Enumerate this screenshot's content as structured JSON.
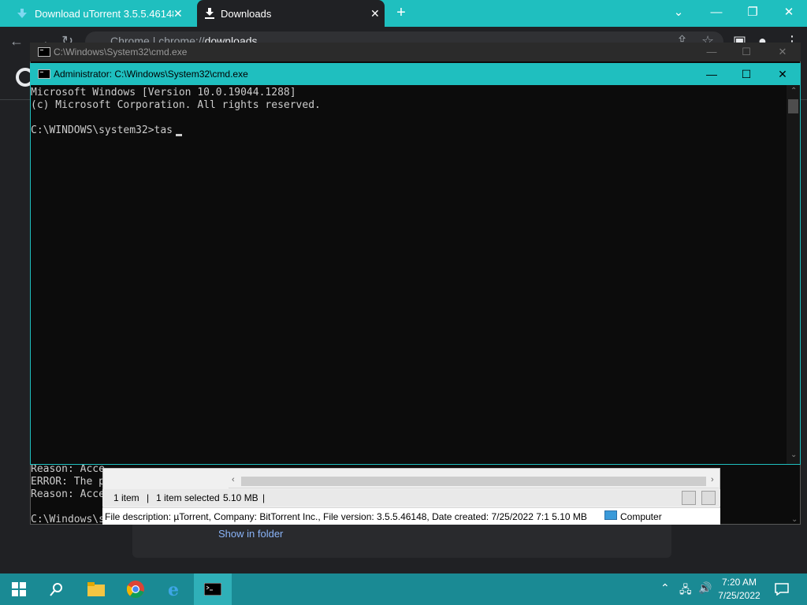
{
  "chrome": {
    "tabs": [
      {
        "label": "Download uTorrent 3.5.5.46148 f",
        "icon": "utorrent-download-icon"
      },
      {
        "label": "Downloads",
        "icon": "download-icon"
      }
    ],
    "omnibox": {
      "prefix": "Chrome",
      "separator": "|",
      "scheme": "chrome://",
      "path": "downloads"
    },
    "downloads_page": {
      "show_in_folder": "Show in folder"
    }
  },
  "cmd_back": {
    "title": "C:\\Windows\\System32\\cmd.exe",
    "lines": [
      "Reason: Acce",
      "ERROR: The p",
      "Reason: Acce",
      "",
      "C:\\Windows\\s"
    ]
  },
  "cmd_front": {
    "title": "Administrator: C:\\Windows\\System32\\cmd.exe",
    "lines": [
      "Microsoft Windows [Version 10.0.19044.1288]",
      "(c) Microsoft Corporation. All rights reserved.",
      "",
      "C:\\WINDOWS\\system32>tas"
    ]
  },
  "explorer": {
    "status_items": "1 item",
    "status_sep": "|",
    "status_selected": "1 item selected",
    "status_size": "5.10 MB",
    "status_sep2": "|",
    "details": "File description: µTorrent, Company: BitTorrent Inc., File version: 3.5.5.46148, Date created: 7/25/2022 7:1 5.10 MB",
    "location": "Computer"
  },
  "taskbar": {
    "time": "7:20 AM",
    "date": "7/25/2022"
  },
  "colors": {
    "accent": "#1fbfbf",
    "taskbar": "#1a8a94"
  }
}
